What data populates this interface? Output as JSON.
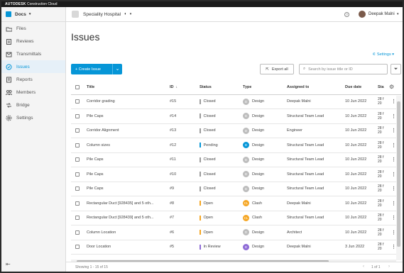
{
  "topbar": {
    "brand": "AUTODESK",
    "product": "Construction Cloud"
  },
  "sidebar": {
    "module": "Docs",
    "items": [
      {
        "label": "Files",
        "icon": "folder-icon"
      },
      {
        "label": "Reviews",
        "icon": "reviews-icon"
      },
      {
        "label": "Transmittals",
        "icon": "transmittals-icon"
      },
      {
        "label": "Issues",
        "icon": "issues-icon",
        "active": true
      },
      {
        "label": "Reports",
        "icon": "reports-icon"
      },
      {
        "label": "Members",
        "icon": "members-icon"
      },
      {
        "label": "Bridge",
        "icon": "bridge-icon"
      },
      {
        "label": "Settings",
        "icon": "gear-icon"
      }
    ]
  },
  "header": {
    "project": "Speciality Hospital",
    "help": "?",
    "user": "Deepak Malni"
  },
  "page": {
    "title": "Issues",
    "settings_label": "Settings",
    "create_label": "Create Issue",
    "export_label": "Export all",
    "search_placeholder": "Search by issue title or ID"
  },
  "table": {
    "columns": [
      "Title",
      "ID",
      "Status",
      "Type",
      "Assigned to",
      "Due date",
      "Sta"
    ],
    "rows": [
      {
        "title": "Corridor grading",
        "id": "#15",
        "status": "Closed",
        "status_color": "#9b9b9b",
        "type_initials": "D",
        "type_color": "#bdbdbd",
        "type": "Design",
        "assigned": "Deepak Malni",
        "due": "10 Jun 2022",
        "start": "28 f 20"
      },
      {
        "title": "Pile Caps",
        "id": "#14",
        "status": "Closed",
        "status_color": "#9b9b9b",
        "type_initials": "D",
        "type_color": "#bdbdbd",
        "type": "Design",
        "assigned": "Structural Team Lead",
        "due": "10 Jun 2022",
        "start": "28 f 20"
      },
      {
        "title": "Corridor Alignment",
        "id": "#13",
        "status": "Closed",
        "status_color": "#9b9b9b",
        "type_initials": "D",
        "type_color": "#bdbdbd",
        "type": "Design",
        "assigned": "Engineer",
        "due": "10 Jun 2022",
        "start": "28 f 20"
      },
      {
        "title": "Column sizes",
        "id": "#12",
        "status": "Pending",
        "status_color": "#0696d7",
        "type_initials": "D",
        "type_color": "#0696d7",
        "type": "Design",
        "assigned": "Structural Team Lead",
        "due": "10 Jun 2022",
        "start": "28 f 20"
      },
      {
        "title": "Pile Caps",
        "id": "#11",
        "status": "Closed",
        "status_color": "#9b9b9b",
        "type_initials": "D",
        "type_color": "#bdbdbd",
        "type": "Design",
        "assigned": "Structural Team Lead",
        "due": "10 Jun 2022",
        "start": "28 f 20"
      },
      {
        "title": "Pile Caps",
        "id": "#10",
        "status": "Closed",
        "status_color": "#9b9b9b",
        "type_initials": "D",
        "type_color": "#bdbdbd",
        "type": "Design",
        "assigned": "Structural Team Lead",
        "due": "10 Jun 2022",
        "start": "28 f 20"
      },
      {
        "title": "Pile Caps",
        "id": "#9",
        "status": "Closed",
        "status_color": "#9b9b9b",
        "type_initials": "D",
        "type_color": "#bdbdbd",
        "type": "Design",
        "assigned": "Structural Team Lead",
        "due": "10 Jun 2022",
        "start": "28 f 20"
      },
      {
        "title": "Rectangular Duct [928435] and 5 oth...",
        "id": "#8",
        "status": "Open",
        "status_color": "#f5a623",
        "type_initials": "CL",
        "type_color": "#f5a623",
        "type": "Clash",
        "assigned": "Deepak Malni",
        "due": "10 Jun 2022",
        "start": "28 f 20"
      },
      {
        "title": "Rectangular Duct [928439] and 5 oth...",
        "id": "#7",
        "status": "Open",
        "status_color": "#f5a623",
        "type_initials": "CL",
        "type_color": "#f5a623",
        "type": "Clash",
        "assigned": "Structural Team Lead",
        "due": "10 Jun 2022",
        "start": "28 f 20"
      },
      {
        "title": "Column Location",
        "id": "#6",
        "status": "Open",
        "status_color": "#f5a623",
        "type_initials": "D",
        "type_color": "#bdbdbd",
        "type": "Design",
        "assigned": "Architect",
        "due": "10 Jun 2022",
        "start": "28 f 20"
      },
      {
        "title": "Door Location",
        "id": "#5",
        "status": "In Review",
        "status_color": "#8e6bd6",
        "type_initials": "D",
        "type_color": "#8e6bd6",
        "type": "Design",
        "assigned": "Deepak Malni",
        "due": "3 Jun 2022",
        "start": "28 f 20"
      }
    ]
  },
  "footer": {
    "showing": "Showing 1 - 15 of 15",
    "pager": "1 of 1"
  }
}
